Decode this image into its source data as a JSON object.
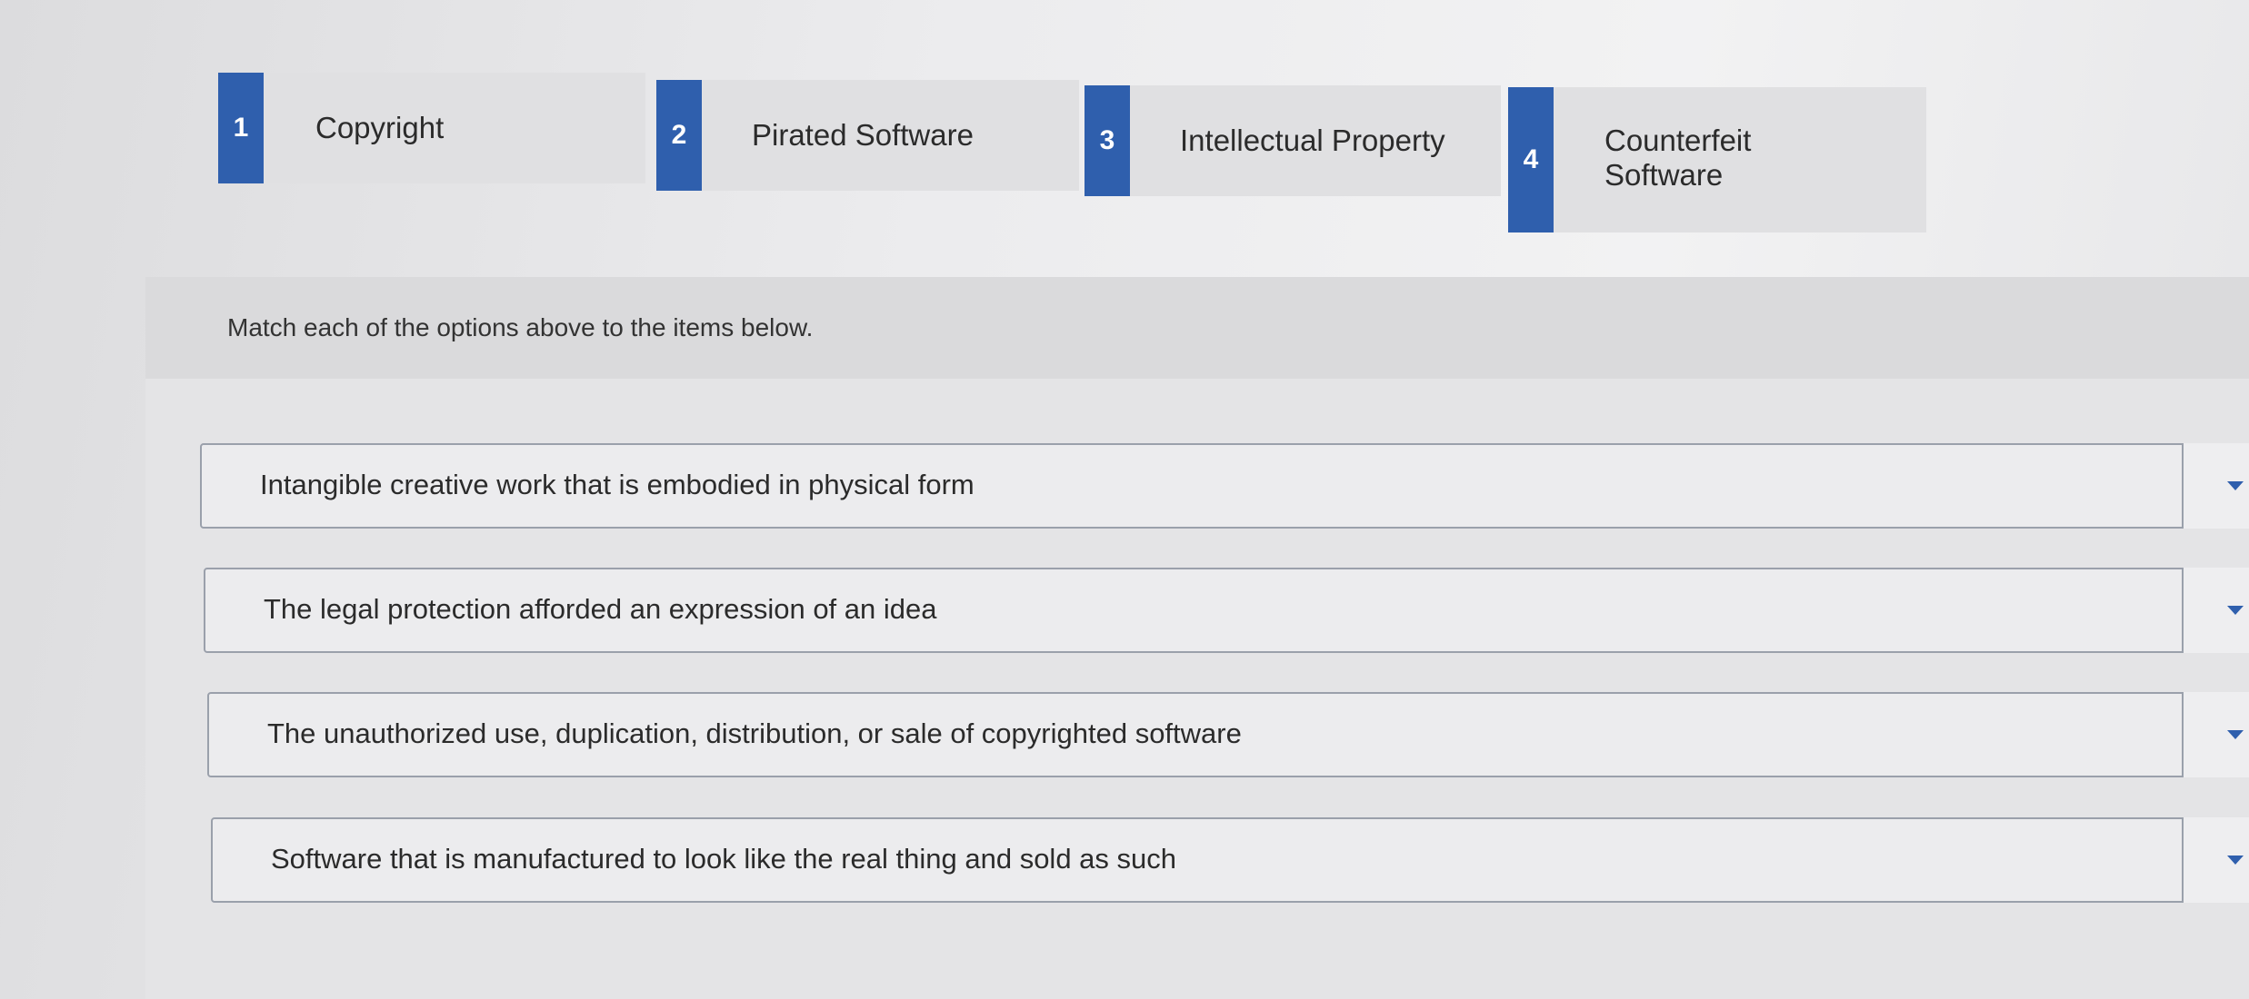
{
  "options": [
    {
      "number": "1",
      "label": "Copyright"
    },
    {
      "number": "2",
      "label": "Pirated Software"
    },
    {
      "number": "3",
      "label": "Intellectual Property"
    },
    {
      "number": "4",
      "label_line1": "Counterfeit",
      "label_line2": "Software"
    }
  ],
  "instruction": "Match each of the options above to the items below.",
  "items": [
    {
      "text": "Intangible creative work that is embodied in physical form"
    },
    {
      "text": "The legal protection afforded an expression of an idea"
    },
    {
      "text": "The unauthorized use, duplication, distribution, or sale of copyrighted software"
    },
    {
      "text": "Software that is manufactured to look like the real thing and sold as such"
    }
  ],
  "colors": {
    "accent": "#2f5fad",
    "card_bg": "#e0e0e2",
    "row_border": "#9aa0ab"
  },
  "icons": {
    "dropdown": "chevron-down-icon"
  }
}
